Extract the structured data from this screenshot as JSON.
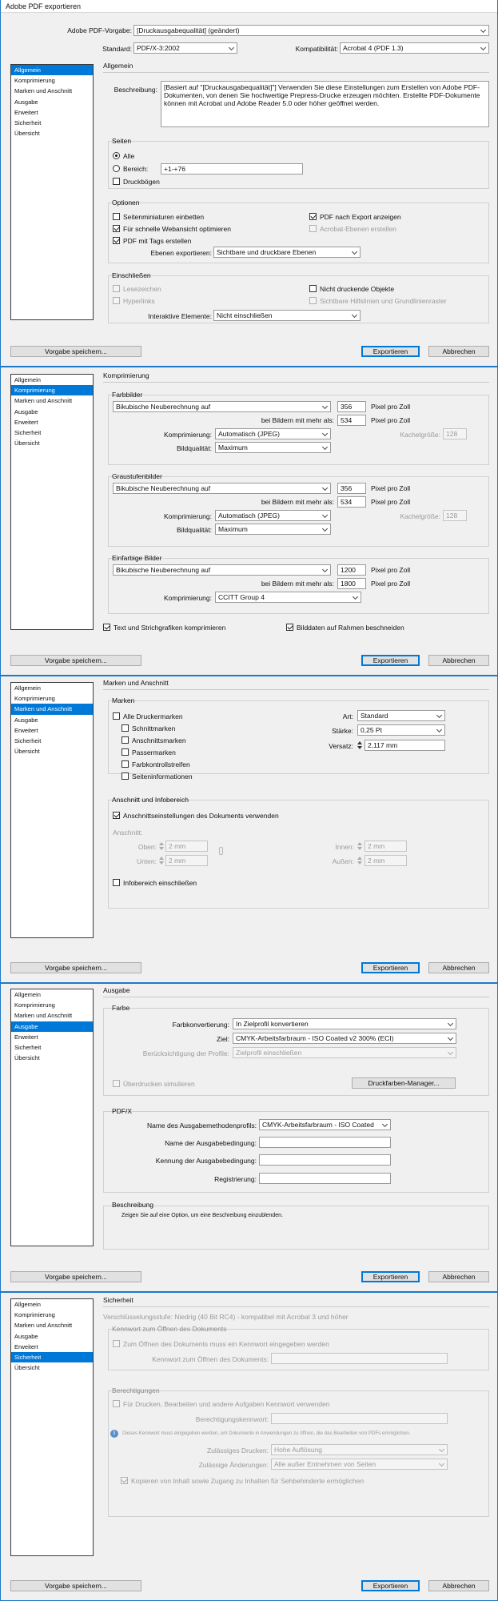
{
  "window": {
    "title": "Adobe PDF exportieren"
  },
  "top": {
    "preset_label": "Adobe PDF-Vorgabe:",
    "preset_value": "[Druckausgabequalität] (geändert)",
    "standard_label": "Standard:",
    "standard_value": "PDF/X-3:2002",
    "compat_label": "Kompatibilität:",
    "compat_value": "Acrobat 4 (PDF 1.3)"
  },
  "sidebar": {
    "items": [
      "Allgemein",
      "Komprimierung",
      "Marken und Anschnitt",
      "Ausgabe",
      "Erweitert",
      "Sicherheit",
      "Übersicht"
    ]
  },
  "footer": {
    "save_preset": "Vorgabe speichern...",
    "export": "Exportieren",
    "cancel": "Abbrechen"
  },
  "general": {
    "header": "Allgemein",
    "description_label": "Beschreibung:",
    "description_text": "[Basiert auf \"[Druckausgabequalität]\"] Verwenden Sie diese Einstellungen zum Erstellen von Adobe PDF-Dokumenten, von denen Sie hochwertige Prepress-Drucke erzeugen möchten. Erstellte PDF-Dokumente können mit Acrobat und Adobe Reader 5.0 oder höher geöffnet werden.",
    "pages_title": "Seiten",
    "all_label": "Alle",
    "range_label": "Bereich:",
    "range_value": "+1-+76",
    "spreads_label": "Druckbögen",
    "options_title": "Optionen",
    "thumbnails_label": "Seitenminiaturen einbetten",
    "fastweb_label": "Für schnelle Webansicht optimieren",
    "tagged_label": "PDF mit Tags erstellen",
    "view_after_label": "PDF nach Export anzeigen",
    "acrobat_layers_label": "Acrobat-Ebenen erstellen",
    "export_layers_label": "Ebenen exportieren:",
    "export_layers_value": "Sichtbare und druckbare Ebenen",
    "include_title": "Einschließen",
    "bookmarks_label": "Lesezeichen",
    "hyperlinks_label": "Hyperlinks",
    "nonprinting_label": "Nicht druckende Objekte",
    "guides_label": "Sichtbare Hilfslinien und Grundlinienraster",
    "interactive_label": "Interaktive Elemente:",
    "interactive_value": "Nicht einschließen"
  },
  "compression": {
    "header": "Komprimierung",
    "blocks": [
      {
        "title": "Farbbilder",
        "method": "Bikubische Neuberechnung auf",
        "ppi": "356",
        "ppi_unit": "Pixel pro Zoll",
        "above_label": "bei Bildern mit mehr als:",
        "above_value": "534",
        "above_unit": "Pixel pro Zoll",
        "comp_label": "Komprimierung:",
        "comp_value": "Automatisch (JPEG)",
        "tile_label": "Kachelgröße:",
        "tile_value": "128",
        "quality_label": "Bildqualität:",
        "quality_value": "Maximum"
      },
      {
        "title": "Graustufenbilder",
        "method": "Bikubische Neuberechnung auf",
        "ppi": "356",
        "ppi_unit": "Pixel pro Zoll",
        "above_label": "bei Bildern mit mehr als:",
        "above_value": "534",
        "above_unit": "Pixel pro Zoll",
        "comp_label": "Komprimierung:",
        "comp_value": "Automatisch (JPEG)",
        "tile_label": "Kachelgröße:",
        "tile_value": "128",
        "quality_label": "Bildqualität:",
        "quality_value": "Maximum"
      },
      {
        "title": "Einfarbige Bilder",
        "method": "Bikubische Neuberechnung auf",
        "ppi": "1200",
        "ppi_unit": "Pixel pro Zoll",
        "above_label": "bei Bildern mit mehr als:",
        "above_value": "1800",
        "above_unit": "Pixel pro Zoll",
        "comp_label": "Komprimierung:",
        "comp_value": "CCITT Group 4"
      }
    ],
    "text_art_label": "Text und Strichgrafiken komprimieren",
    "crop_label": "Bilddaten auf Rahmen beschneiden"
  },
  "marks": {
    "header": "Marken und Anschnitt",
    "marks_title": "Marken",
    "all_marks": "Alle Druckermarken",
    "crop": "Schnittmarken",
    "bleed": "Anschnittsmarken",
    "registration": "Passermarken",
    "color_bars": "Farbkontrollstreifen",
    "page_info": "Seiteninformationen",
    "type_label": "Art:",
    "type_value": "Standard",
    "weight_label": "Stärke:",
    "weight_value": "0,25 Pt",
    "offset_label": "Versatz:",
    "offset_value": "2,117 mm",
    "bleed_title": "Anschnitt und Infobereich",
    "use_doc_bleed": "Anschnittseinstellungen des Dokuments verwenden",
    "bleed_label": "Anschnitt:",
    "top_label": "Oben:",
    "top_value": "2 mm",
    "bottom_label": "Unten:",
    "bottom_value": "2 mm",
    "inside_label": "Innen:",
    "inside_value": "2 mm",
    "outside_label": "Außen:",
    "outside_value": "2 mm",
    "slug_label": "Infobereich einschließen"
  },
  "output": {
    "header": "Ausgabe",
    "color_title": "Farbe",
    "conversion_label": "Farbkonvertierung:",
    "conversion_value": "In Zielprofil konvertieren",
    "dest_label": "Ziel:",
    "dest_value": "CMYK-Arbeitsfarbraum - ISO Coated v2 300% (ECI)",
    "profile_label": "Berücksichtigung der Profile:",
    "profile_value": "Zielprofil einschließen",
    "overprint_label": "Überdrucken simulieren",
    "ink_manager": "Druckfarben-Manager...",
    "pdfx_title": "PDF/X",
    "intent_profile_label": "Name des Ausgabemethodenprofils:",
    "intent_profile_value": "CMYK-Arbeitsfarbraum - ISO Coated",
    "condition_name_label": "Name der Ausgabebedingung:",
    "condition_id_label": "Kennung der Ausgabebedingung:",
    "registry_label": "Registrierung:",
    "desc_title": "Beschreibung",
    "desc_text": "Zeigen Sie auf eine Option, um eine Beschreibung einzublenden."
  },
  "security": {
    "header": "Sicherheit",
    "level": "Verschlüsselungsstufe: Niedrig (40 Bit RC4) - kompatibel mit Acrobat 3 und höher",
    "open_title": "Kennwort zum Öffnen des Dokuments",
    "open_required": "Zum Öffnen des Dokuments muss ein Kennwort eingegeben werden",
    "open_pw_label": "Kennwort zum Öffnen des Dokuments:",
    "perm_title": "Berechtigungen",
    "perm_required": "Für Drucken, Bearbeiten und andere Aufgaben Kennwort verwenden",
    "perm_pw_label": "Berechtigungskennwort:",
    "info_text": "Dieses Kennwort muss eingegeben werden, um Dokumente in Anwendungen zu öffnen, die das Bearbeiten von PDFs ermöglichen.",
    "printing_label": "Zulässiges Drucken:",
    "printing_value": "Hohe Auflösung",
    "changes_label": "Zulässige Änderungen:",
    "changes_value": "Alle außer Entnehmen von Seiten",
    "copy_label": "Kopieren von Inhalt sowie Zugang zu Inhalten für Sehbehinderte ermöglichen"
  },
  "colors": {
    "accent": "#0078d7",
    "frame": "#1e78c8",
    "background": "#f0f0f0"
  }
}
